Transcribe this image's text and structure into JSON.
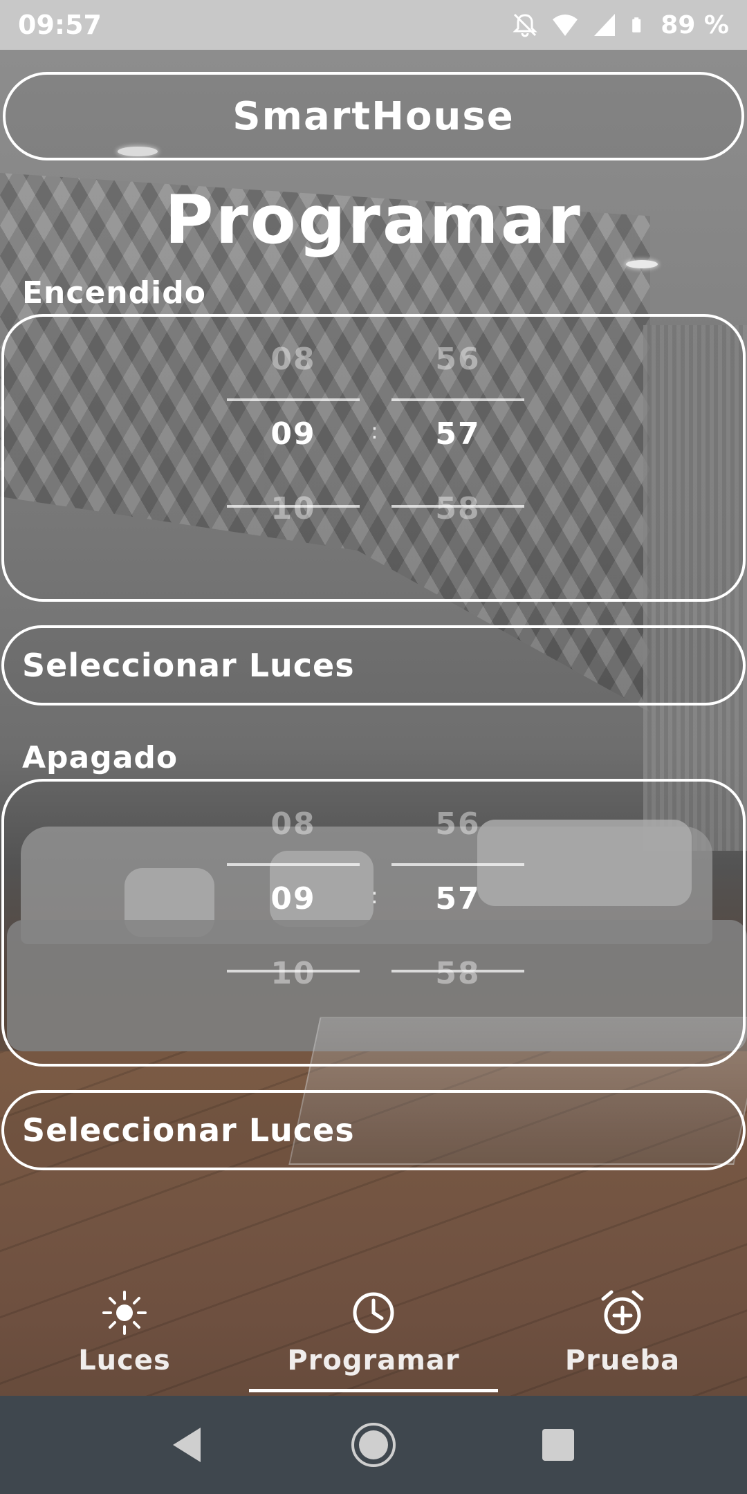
{
  "status_bar": {
    "time": "09:57",
    "battery": "89 %",
    "icons": [
      "notifications-off-icon",
      "wifi-icon",
      "signal-icon",
      "battery-icon"
    ]
  },
  "app": {
    "title": "SmartHouse",
    "page_title": "Programar"
  },
  "on_section": {
    "label": "Encendido",
    "hour": {
      "prev": "08",
      "current": "09",
      "next": "10"
    },
    "minute": {
      "prev": "56",
      "current": "57",
      "next": "58"
    },
    "separator": ":",
    "select_button": "Seleccionar Luces"
  },
  "off_section": {
    "label": "Apagado",
    "hour": {
      "prev": "08",
      "current": "09",
      "next": "10"
    },
    "minute": {
      "prev": "56",
      "current": "57",
      "next": "58"
    },
    "separator": ":",
    "select_button": "Seleccionar Luces"
  },
  "bottom_nav": {
    "items": [
      {
        "label": "Luces",
        "icon": "sun-icon",
        "active": false
      },
      {
        "label": "Programar",
        "icon": "clock-icon",
        "active": true
      },
      {
        "label": "Prueba",
        "icon": "alarm-add-icon",
        "active": false
      }
    ]
  },
  "system_nav": {
    "buttons": [
      "back-icon",
      "home-icon",
      "recents-icon"
    ]
  },
  "colors": {
    "status_bar": "#c8c8c8",
    "system_nav": "#3f474e",
    "text": "#ffffff",
    "muted_text": "#b8b8b8"
  }
}
